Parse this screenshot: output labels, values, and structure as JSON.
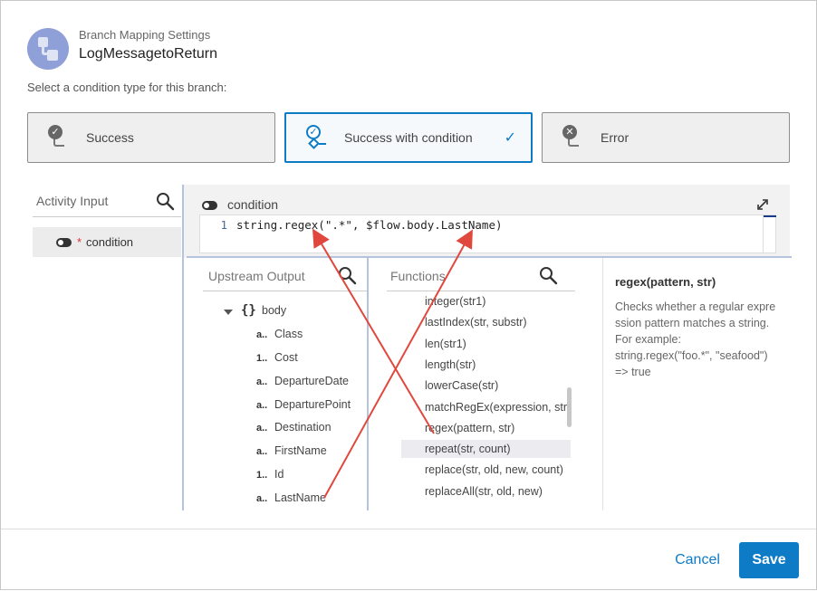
{
  "header": {
    "subtitle": "Branch Mapping Settings",
    "title": "LogMessagetoReturn",
    "icon": "branch-icon"
  },
  "prompt": "Select a condition type for this branch:",
  "condition_types": [
    {
      "label": "Success",
      "icon": "success-branch-icon",
      "selected": false
    },
    {
      "label": "Success with condition",
      "icon": "conditional-branch-icon",
      "selected": true
    },
    {
      "label": "Error",
      "icon": "error-branch-icon",
      "selected": false
    }
  ],
  "activity_input": {
    "title": "Activity Input",
    "items": [
      {
        "label": "condition",
        "required_mark": "*"
      }
    ]
  },
  "editor": {
    "label": "condition",
    "line_number": "1",
    "code": "string.regex(\".*\", $flow.body.LastName)"
  },
  "upstream": {
    "title": "Upstream Output",
    "root": {
      "label": "body",
      "type": "{}"
    },
    "fields": [
      {
        "type": "a..",
        "name": "Class"
      },
      {
        "type": "1..",
        "name": "Cost"
      },
      {
        "type": "a..",
        "name": "DepartureDate"
      },
      {
        "type": "a..",
        "name": "DeparturePoint"
      },
      {
        "type": "a..",
        "name": "Destination"
      },
      {
        "type": "a..",
        "name": "FirstName"
      },
      {
        "type": "1..",
        "name": "Id"
      },
      {
        "type": "a..",
        "name": "LastName"
      }
    ]
  },
  "functions": {
    "title": "Functions",
    "items": [
      "integer(str1)",
      "lastIndex(str, substr)",
      "len(str1)",
      "length(str)",
      "lowerCase(str)",
      "matchRegEx(expression, str)",
      "regex(pattern, str)",
      "repeat(str, count)",
      "replace(str, old, new, count)",
      "replaceAll(str, old, new)"
    ],
    "highlighted": "repeat(str, count)"
  },
  "description": {
    "title": "regex(pattern, str)",
    "lines": [
      "Checks whether a regular expre",
      "ssion pattern matches a string.",
      "For example:",
      "string.regex(\"foo.*\", \"seafood\")",
      "=> true"
    ]
  },
  "footer": {
    "cancel": "Cancel",
    "save": "Save"
  },
  "colors": {
    "accent": "#0d7bc6",
    "annotation_arrow": "#e0483e"
  }
}
